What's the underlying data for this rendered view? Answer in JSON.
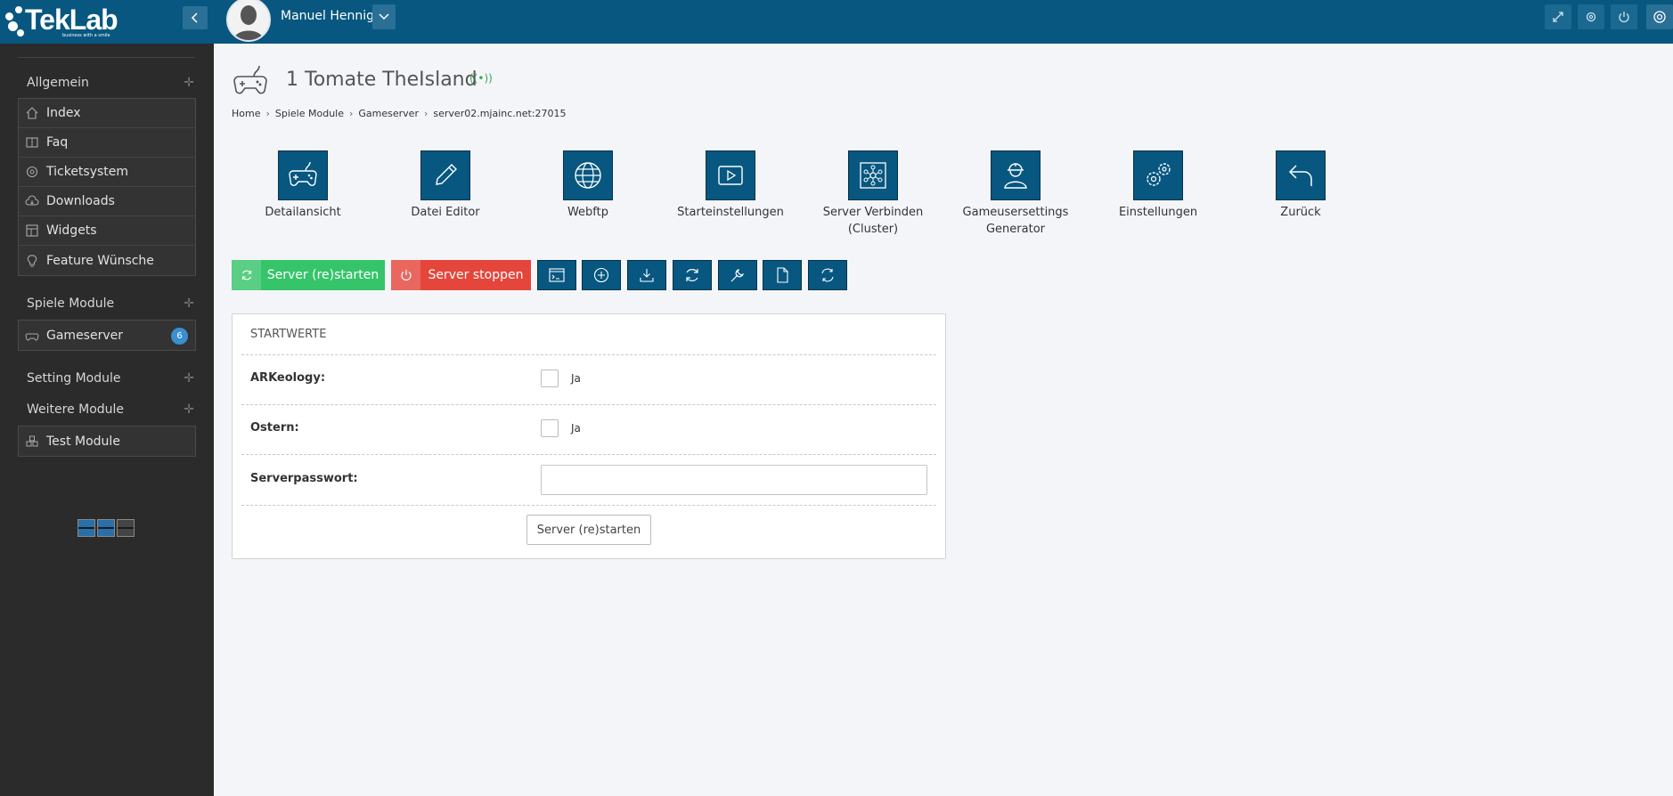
{
  "brand": {
    "name": "TekLab",
    "slogan": "business with a smile"
  },
  "user": {
    "name": "Manuel Hennig"
  },
  "sidebar": {
    "sections": [
      {
        "title": "Allgemein"
      },
      {
        "title": "Spiele Module"
      },
      {
        "title": "Setting Module"
      },
      {
        "title": "Weitere Module"
      }
    ],
    "allgemein_items": [
      {
        "label": "Index",
        "icon": "home-icon"
      },
      {
        "label": "Faq",
        "icon": "book-icon"
      },
      {
        "label": "Ticketsystem",
        "icon": "ticket-icon"
      },
      {
        "label": "Downloads",
        "icon": "cloud-download-icon"
      },
      {
        "label": "Widgets",
        "icon": "widgets-icon"
      },
      {
        "label": "Feature Wünsche",
        "icon": "lightbulb-icon"
      }
    ],
    "gameserver": {
      "label": "Gameserver",
      "badge": "6",
      "icon": "gamepad-icon"
    },
    "test_module": {
      "label": "Test Module",
      "icon": "cubes-icon"
    }
  },
  "page": {
    "title": "1 Tomate TheIsland",
    "signal": "((•))",
    "breadcrumb": [
      "Home",
      "Spiele Module",
      "Gameserver",
      "server02.mjainc.net:27015"
    ]
  },
  "tiles": [
    {
      "label": "Detailansicht",
      "icon": "gamepad-icon"
    },
    {
      "label": "Datei Editor",
      "icon": "pencil-icon"
    },
    {
      "label": "Webftp",
      "icon": "globe-icon"
    },
    {
      "label": "Starteinstellungen",
      "icon": "play-icon"
    },
    {
      "label": "Server Verbinden (Cluster)",
      "icon": "network-icon"
    },
    {
      "label": "Gameusersettings Generator",
      "icon": "worker-icon"
    },
    {
      "label": "Einstellungen",
      "icon": "gears-icon"
    },
    {
      "label": "Zurück",
      "icon": "undo-icon"
    }
  ],
  "actions": {
    "start_label": "Server (re)starten",
    "stop_label": "Server stoppen",
    "icon_buttons": [
      "console-icon",
      "plus-circle-icon",
      "download-icon",
      "refresh-icon",
      "wrench-icon",
      "file-icon",
      "sync-icon"
    ]
  },
  "form": {
    "title": "STARTWERTE",
    "rows": [
      {
        "label": "ARKeology:",
        "checkbox_label": "Ja",
        "checked": false
      },
      {
        "label": "Ostern:",
        "checkbox_label": "Ja",
        "checked": false
      }
    ],
    "password_label": "Serverpasswort:",
    "password_value": "",
    "submit_label": "Server (re)starten"
  },
  "colors": {
    "topbar": "#075780",
    "sidebar": "#2b2b2b",
    "start": "#36c46a",
    "stop": "#e4463c",
    "badge": "#3a8fd0"
  }
}
